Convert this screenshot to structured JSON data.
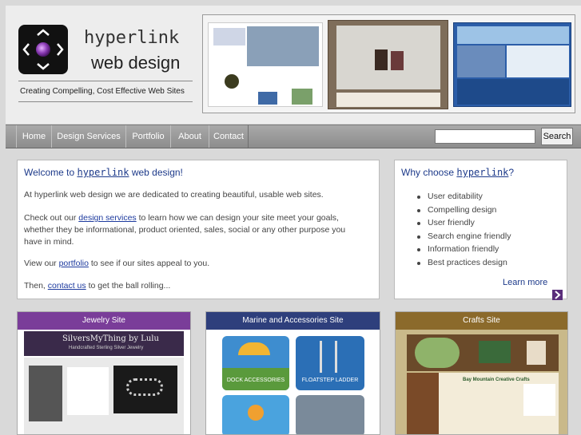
{
  "logo": {
    "word1": "hyperlink",
    "word2": "web design"
  },
  "tagline": "Creating Compelling, Cost Effective Web Sites",
  "nav": {
    "items": [
      "Home",
      "Design Services",
      "Portfolio",
      "About",
      "Contact"
    ]
  },
  "search": {
    "placeholder": "",
    "button": "Search"
  },
  "welcome": {
    "title_prefix": "Welcome to ",
    "title_brand": "hyperlink",
    "title_suffix": " web design!",
    "p1": "At hyperlink web design we are dedicated to creating beautiful, usable web sites.",
    "p2_before": "Check out our ",
    "p2_link": "design services",
    "p2_after": " to learn how we can design your site meet your goals, whether they be informational, product oriented, sales, social or any other purpose you have in mind.",
    "p3_before": "View our ",
    "p3_link": "portfolio",
    "p3_after": " to see if our sites appeal to you.",
    "p4_before": "Then, ",
    "p4_link": "contact us",
    "p4_after": " to get the ball rolling..."
  },
  "why": {
    "title_prefix": "Why choose ",
    "title_brand": "hyperlink",
    "title_suffix": "?",
    "items": [
      "User editability",
      "Compelling design",
      "User friendly",
      "Search engine friendly",
      "Information friendly",
      "Best practices design"
    ],
    "learn_more": "Learn more"
  },
  "sites": [
    {
      "title": "Jewelry Site",
      "color": "#7a3d99"
    },
    {
      "title": "Marine and Accessories Site",
      "color": "#2e3f7c"
    },
    {
      "title": "Crafts Site",
      "color": "#8b6a2b"
    }
  ],
  "jewelry_thumb": {
    "brand": "SilversMyThing by Lulu",
    "sub": "Handcrafted Sterling Silver Jewelry"
  },
  "marine_thumb": {
    "tile1": "DOCK ACCESSORIES",
    "tile2": "FLOATSTEP LADDER"
  },
  "crafts_thumb": {
    "heading": "Bay Mountain Creative Crafts"
  }
}
